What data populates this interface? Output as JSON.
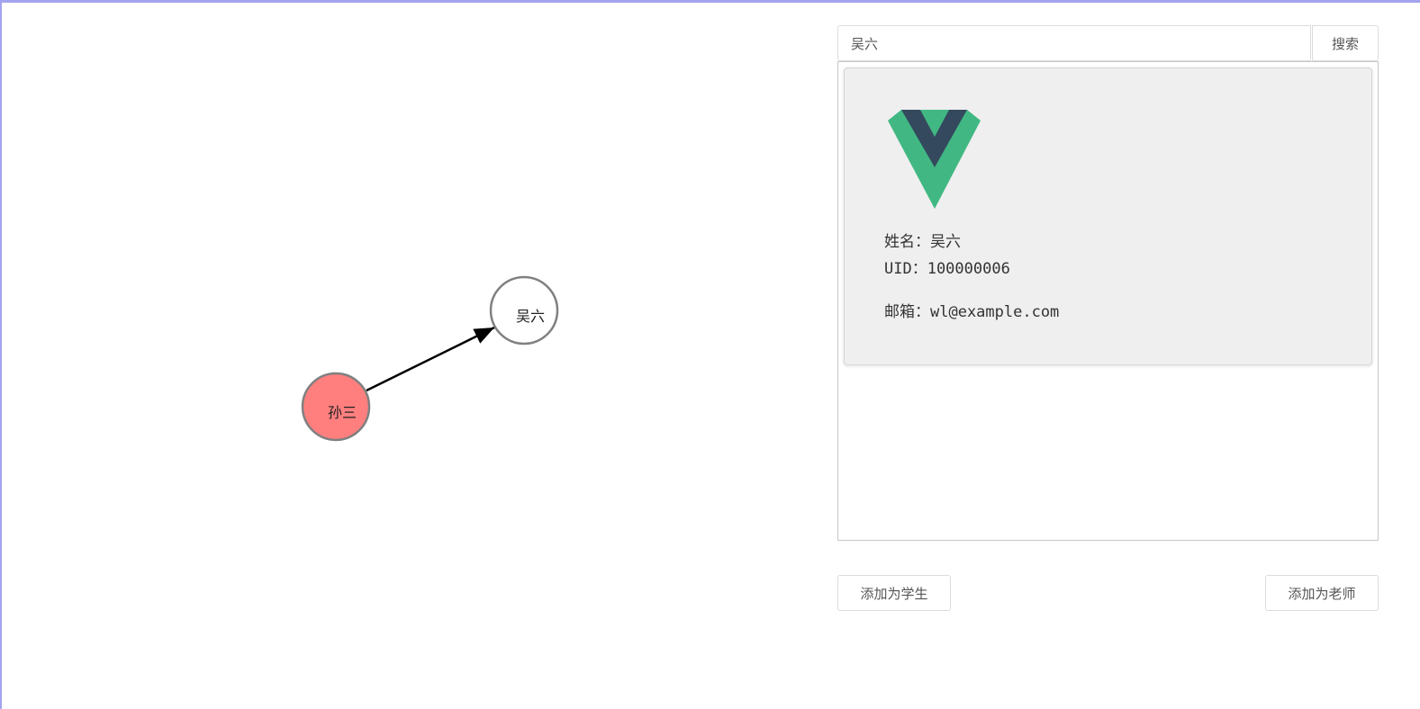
{
  "graph": {
    "nodes": [
      {
        "label": "孙三",
        "fill": "#ff7f7f",
        "role": "source"
      },
      {
        "label": "吴六",
        "fill": "#ffffff",
        "role": "target"
      }
    ],
    "edge": {
      "from": "孙三",
      "to": "吴六",
      "color": "#000000"
    }
  },
  "search": {
    "value": "吴六",
    "button_label": "搜索"
  },
  "result_card": {
    "name_line": "姓名：吴六",
    "uid_line": "UID：100000006",
    "email_line": "邮箱：wl@example.com",
    "avatar_icon": "vue-logo-icon",
    "avatar_colors": {
      "outer": "#41b883",
      "inner": "#34495e"
    },
    "background": "#efefef"
  },
  "actions": {
    "add_student_label": "添加为学生",
    "add_teacher_label": "添加为老师"
  },
  "colors": {
    "frame_accent": "#a3a3f0",
    "node_stroke": "#808080"
  }
}
